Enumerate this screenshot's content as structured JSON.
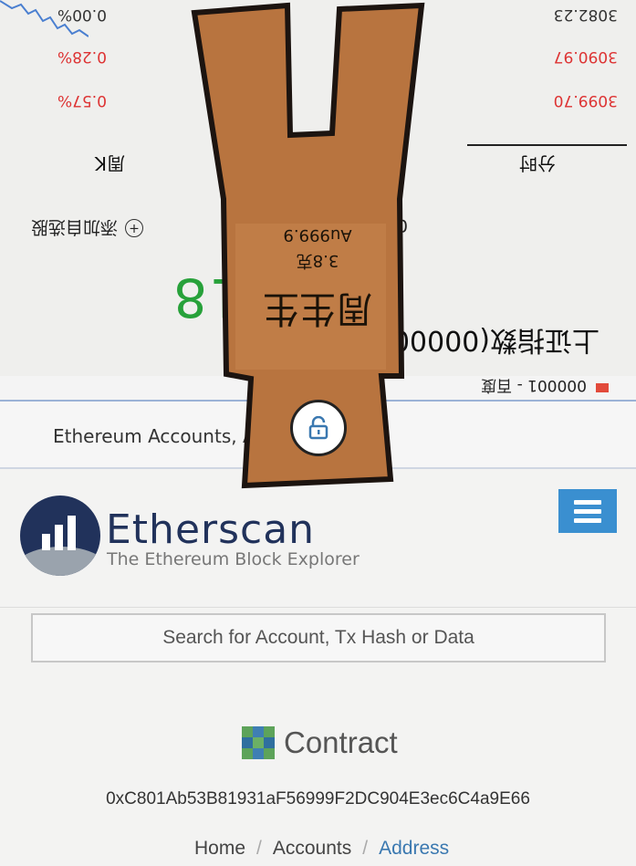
{
  "stock_app": {
    "tab_title": "000001 - 百度",
    "stock_name": "上证指数(000001",
    "price": "3081.18",
    "timestamp": "05-02 15:00:00 (北京",
    "add_watchlist": "添加自选股",
    "period_tabs": [
      "分时",
      "周K"
    ],
    "quotes": [
      {
        "value": "3099.70",
        "change": "0.57%"
      },
      {
        "value": "3090.97",
        "change": "0.28%"
      },
      {
        "value": "3082.23",
        "change": "0.00%"
      }
    ],
    "colors": {
      "price": "#27a13a",
      "change": "#d33333"
    }
  },
  "browser": {
    "url_text": "Ethereum Accounts, A"
  },
  "etherscan": {
    "brand_name": "Etherscan",
    "tagline": "The Ethereum Block Explorer",
    "search_placeholder": "Search for Account, Tx Hash or Data",
    "contract_label": "Contract",
    "address": "0xC801Ab53B81931aF56999F2DC904E3ec6C4a9E66",
    "breadcrumb": [
      "Home",
      "Accounts",
      "Address"
    ],
    "colors": {
      "brand": "#21325b",
      "menu": "#3a8fd0",
      "link": "#3a78b0"
    }
  },
  "key_overlay": {
    "title": "周生生",
    "weight": "3.8克",
    "purity": "Au999.9",
    "unlock_icon": "unlock-icon",
    "color": "#b8743f"
  }
}
